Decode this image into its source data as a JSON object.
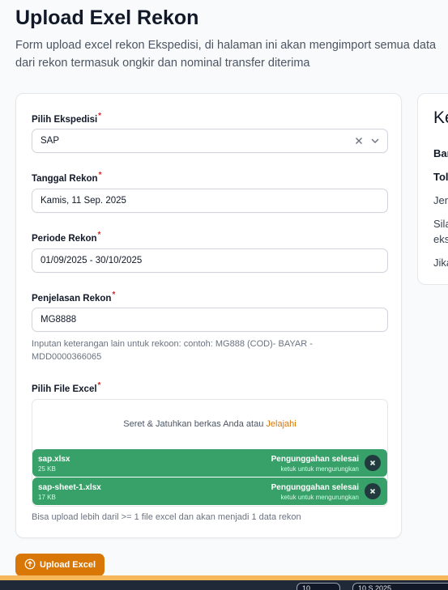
{
  "page": {
    "title": "Upload Exel Rekon",
    "description": "Form upload excel rekon Ekspedisi, di halaman ini akan mengimport semua data dari rekon termasuk ongkir dan nominal transfer diterima"
  },
  "form": {
    "ekspedisi": {
      "label": "Pilih Ekspedisi",
      "value": "SAP",
      "required": "*"
    },
    "tanggal": {
      "label": "Tanggal Rekon",
      "value": "Kamis, 11 Sep. 2025",
      "required": "*"
    },
    "periode": {
      "label": "Periode Rekon",
      "value": "01/09/2025 - 30/10/2025",
      "required": "*"
    },
    "penjelasan": {
      "label": "Penjelasan Rekon",
      "value": "MG8888",
      "required": "*",
      "hint": "Inputan keterangan lain untuk rekoon: contoh: MG888 (COD)- BAYAR - MDD0000366065"
    },
    "file": {
      "label": "Pilih File Excel",
      "required": "*",
      "drop_text": "Seret & Jatuhkan berkas Anda atau",
      "browse_text": "Jelajahi",
      "files": [
        {
          "name": "sap.xlsx",
          "size": "25 KB",
          "status": "Pengunggahan selesai",
          "action": "ketuk untuk mengurungkan"
        },
        {
          "name": "sap-sheet-1.xlsx",
          "size": "17 KB",
          "status": "Pengunggahan selesai",
          "action": "ketuk untuk mengurungkan"
        }
      ],
      "hint": "Bisa upload lebih daril >= 1 file excel dan akan menjadi 1 data rekon"
    },
    "submit_label": "Upload Excel"
  },
  "side_card": {
    "title": "Ke",
    "lines": [
      "Bar",
      "Tol",
      "Jen",
      "Sila",
      "eks",
      "Jika"
    ]
  },
  "bottom_bar": {
    "pill1": "10",
    "pill2": "10 S     2025"
  },
  "colors": {
    "accent": "#d97706",
    "success": "#38a169",
    "required": "#dc2626"
  }
}
